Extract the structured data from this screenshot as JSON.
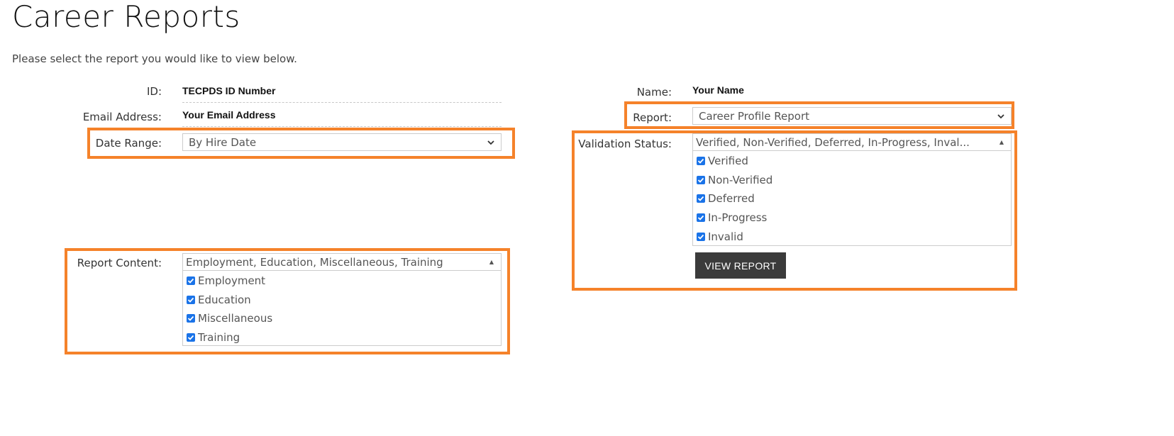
{
  "page": {
    "title": "Career Reports",
    "intro": "Please select the report you would like to view below."
  },
  "left": {
    "id": {
      "label": "ID:",
      "value": "TECPDS ID Number"
    },
    "email": {
      "label": "Email Address:",
      "value": "Your Email Address"
    },
    "date_range": {
      "label": "Date Range:",
      "selected": "By Hire Date"
    },
    "report_content": {
      "label": "Report Content:",
      "summary": "Employment, Education, Miscellaneous, Training",
      "options": [
        {
          "label": "Employment",
          "checked": true
        },
        {
          "label": "Education",
          "checked": true
        },
        {
          "label": "Miscellaneous",
          "checked": true
        },
        {
          "label": "Training",
          "checked": true
        }
      ]
    }
  },
  "right": {
    "name": {
      "label": "Name:",
      "value": "Your Name"
    },
    "report": {
      "label": "Report:",
      "selected": "Career Profile Report"
    },
    "validation_status": {
      "label": "Validation Status:",
      "summary": "Verified, Non-Verified, Deferred, In-Progress, Inval...",
      "options": [
        {
          "label": "Verified",
          "checked": true
        },
        {
          "label": "Non-Verified",
          "checked": true
        },
        {
          "label": "Deferred",
          "checked": true
        },
        {
          "label": "In-Progress",
          "checked": true
        },
        {
          "label": "Invalid",
          "checked": true
        }
      ]
    },
    "view_report_label": "VIEW REPORT"
  },
  "colors": {
    "highlight": "#f5822a",
    "checkbox": "#1a73e8",
    "button_bg": "#3b3b3b"
  },
  "icons": {
    "dropdown": "chevron-down-icon",
    "multiselect_toggle": "triangle-up-icon",
    "checked": "checkmark-icon"
  }
}
